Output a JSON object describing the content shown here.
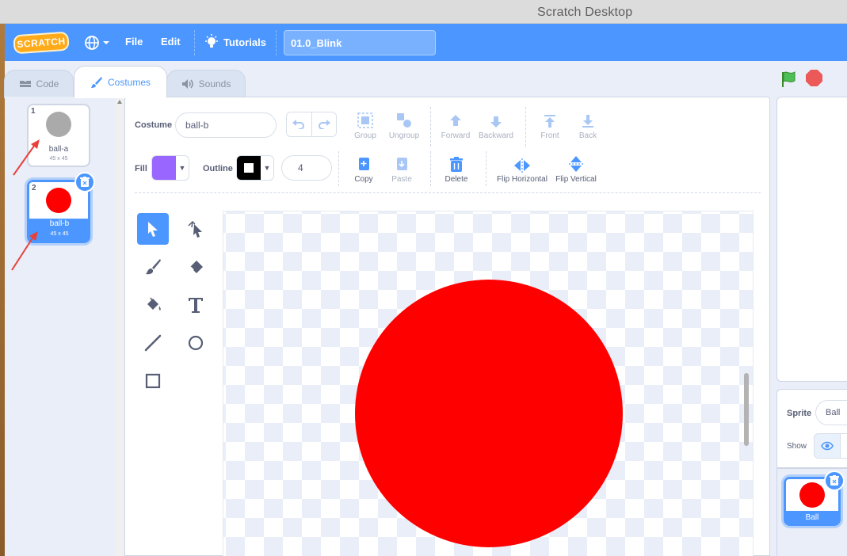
{
  "window": {
    "title": "Scratch Desktop"
  },
  "menubar": {
    "logo": "SCRATCH",
    "file": "File",
    "edit": "Edit",
    "tutorials": "Tutorials",
    "project_title": "01.0_Blink",
    "accent": "#4c97ff"
  },
  "tabs": [
    {
      "label": "Code",
      "icon": "code-icon"
    },
    {
      "label": "Costumes",
      "icon": "brush-icon",
      "active": true
    },
    {
      "label": "Sounds",
      "icon": "speaker-icon"
    }
  ],
  "costumes": [
    {
      "number": "1",
      "name": "ball-a",
      "size": "45 x 45",
      "color": "#aaaaaa"
    },
    {
      "number": "2",
      "name": "ball-b",
      "size": "45 x 45",
      "color": "#ff0000",
      "selected": true
    }
  ],
  "editor": {
    "costume_label": "Costume",
    "costume_name": "ball-b",
    "fill_label": "Fill",
    "fill_color": "#9966ff",
    "outline_label": "Outline",
    "outline_color": "#000000",
    "stroke_width": "4",
    "actions": {
      "group": "Group",
      "ungroup": "Ungroup",
      "forward": "Forward",
      "backward": "Backward",
      "front": "Front",
      "back": "Back",
      "copy": "Copy",
      "paste": "Paste",
      "delete": "Delete",
      "flip_horizontal": "Flip Horizontal",
      "flip_vertical": "Flip Vertical"
    },
    "tools": [
      "select",
      "reshape",
      "brush",
      "eraser",
      "fill",
      "text",
      "line",
      "circle",
      "rectangle"
    ],
    "active_tool": "select",
    "shape_color": "#ff0000"
  },
  "sprite": {
    "sprite_label": "Sprite",
    "sprite_name": "Ball",
    "show_label": "Show",
    "tile_name": "Ball"
  }
}
